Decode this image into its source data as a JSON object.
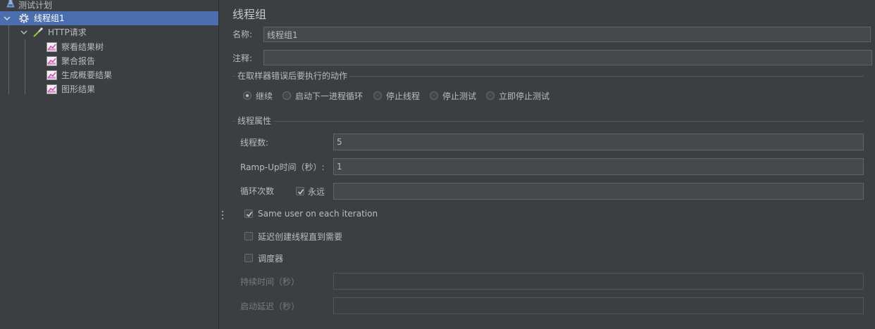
{
  "tree": {
    "items": [
      {
        "label": "测试计划",
        "icon": "test-plan-icon"
      },
      {
        "label": "线程组1",
        "icon": "gear-icon",
        "selected": true
      },
      {
        "label": "HTTP请求",
        "icon": "pipette-icon"
      },
      {
        "label": "察看结果树",
        "icon": "listener-chart-icon"
      },
      {
        "label": "聚合报告",
        "icon": "listener-chart-icon"
      },
      {
        "label": "生成概要结果",
        "icon": "listener-chart-icon"
      },
      {
        "label": "图形结果",
        "icon": "listener-chart-icon"
      }
    ]
  },
  "form": {
    "title": "线程组",
    "name_label": "名称:",
    "name_value": "线程组1",
    "comment_label": "注释:",
    "comment_value": "",
    "error_section": "在取样器错误后要执行的动作",
    "error_actions": [
      {
        "label": "继续",
        "checked": true
      },
      {
        "label": "启动下一进程循环",
        "checked": false
      },
      {
        "label": "停止线程",
        "checked": false
      },
      {
        "label": "停止测试",
        "checked": false
      },
      {
        "label": "立即停止测试",
        "checked": false
      }
    ],
    "props_section": "线程属性",
    "threads_label": "线程数:",
    "threads_value": "5",
    "rampup_label": "Ramp-Up时间（秒）:",
    "rampup_value": "1",
    "loop_label": "循环次数",
    "forever_label": "永远",
    "forever_checked": true,
    "loop_value": "",
    "same_user_label": "Same user on each iteration",
    "same_user_checked": true,
    "delay_label": "延迟创建线程直到需要",
    "delay_checked": false,
    "scheduler_label": "调度器",
    "scheduler_checked": false,
    "duration_label": "持续时间（秒）",
    "duration_value": "",
    "startup_delay_label": "启动延迟（秒）",
    "startup_delay_value": ""
  },
  "colors": {
    "background": "#3c3f41",
    "selection": "#4b6eaf",
    "field": "#45494a",
    "text": "#bbbbbb"
  }
}
